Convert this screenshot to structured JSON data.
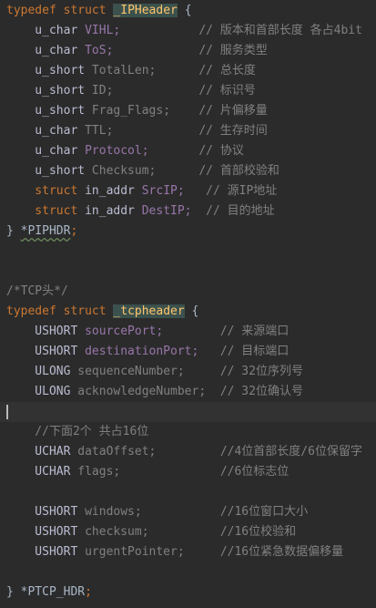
{
  "colors": {
    "background": "#2b2b2b",
    "keyword": "#cc7832",
    "type": "#b9bcd1",
    "field_purple": "#9876aa",
    "field_gray": "#808080",
    "comment": "#808080",
    "plain": "#a9b7c6",
    "struct_name": "#ffc66d",
    "current_line": "#323232",
    "brace_highlight": "#3b514d"
  },
  "lines": [
    {
      "tokens": [
        {
          "text": "typedef ",
          "c": "keyword"
        },
        {
          "text": "struct ",
          "c": "keyword"
        },
        {
          "text": "_IPHeader",
          "c": "struct_name",
          "hl": true
        },
        {
          "text": " {",
          "c": "plain"
        }
      ]
    },
    {
      "tokens": [
        {
          "text": "    u_char ",
          "c": "type"
        },
        {
          "text": "VIHL;",
          "c": "field_purple"
        },
        {
          "text": "           ",
          "c": "plain"
        },
        {
          "text": "// 版本和首部长度 各占4bit",
          "c": "comment"
        }
      ]
    },
    {
      "tokens": [
        {
          "text": "    u_char ",
          "c": "type"
        },
        {
          "text": "ToS;",
          "c": "field_purple"
        },
        {
          "text": "            ",
          "c": "plain"
        },
        {
          "text": "// 服务类型",
          "c": "comment"
        }
      ]
    },
    {
      "tokens": [
        {
          "text": "    u_short ",
          "c": "type"
        },
        {
          "text": "TotalLen;",
          "c": "field_gray"
        },
        {
          "text": "      ",
          "c": "plain"
        },
        {
          "text": "// 总长度",
          "c": "comment"
        }
      ]
    },
    {
      "tokens": [
        {
          "text": "    u_short ",
          "c": "type"
        },
        {
          "text": "ID;",
          "c": "field_gray"
        },
        {
          "text": "            ",
          "c": "plain"
        },
        {
          "text": "// 标识号",
          "c": "comment"
        }
      ]
    },
    {
      "tokens": [
        {
          "text": "    u_short ",
          "c": "type"
        },
        {
          "text": "Frag_Flags;",
          "c": "field_gray"
        },
        {
          "text": "    ",
          "c": "plain"
        },
        {
          "text": "// 片偏移量",
          "c": "comment"
        }
      ]
    },
    {
      "tokens": [
        {
          "text": "    u_char ",
          "c": "type"
        },
        {
          "text": "TTL;",
          "c": "field_gray"
        },
        {
          "text": "            ",
          "c": "plain"
        },
        {
          "text": "// 生存时间",
          "c": "comment"
        }
      ]
    },
    {
      "tokens": [
        {
          "text": "    u_char ",
          "c": "type"
        },
        {
          "text": "Protocol;",
          "c": "field_purple"
        },
        {
          "text": "       ",
          "c": "plain"
        },
        {
          "text": "// 协议",
          "c": "comment"
        }
      ]
    },
    {
      "tokens": [
        {
          "text": "    u_short ",
          "c": "type"
        },
        {
          "text": "Checksum;",
          "c": "field_gray"
        },
        {
          "text": "      ",
          "c": "plain"
        },
        {
          "text": "// 首部校验和",
          "c": "comment"
        }
      ]
    },
    {
      "tokens": [
        {
          "text": "    struct ",
          "c": "keyword"
        },
        {
          "text": "in_addr ",
          "c": "type"
        },
        {
          "text": "SrcIP;",
          "c": "field_purple"
        },
        {
          "text": "   ",
          "c": "plain"
        },
        {
          "text": "// 源IP地址",
          "c": "comment"
        }
      ]
    },
    {
      "tokens": [
        {
          "text": "    struct ",
          "c": "keyword"
        },
        {
          "text": "in_addr ",
          "c": "type"
        },
        {
          "text": "DestIP;",
          "c": "field_purple"
        },
        {
          "text": "  ",
          "c": "plain"
        },
        {
          "text": "// 目的地址",
          "c": "comment"
        }
      ]
    },
    {
      "tokens": [
        {
          "text": "} ",
          "c": "plain"
        },
        {
          "text": "*PIPHDR",
          "c": "plain",
          "squiggle": true
        },
        {
          "text": ";",
          "c": "keyword"
        }
      ]
    },
    {
      "tokens": []
    },
    {
      "tokens": []
    },
    {
      "tokens": [
        {
          "text": "/*TCP头*/",
          "c": "comment"
        }
      ]
    },
    {
      "tokens": [
        {
          "text": "typedef ",
          "c": "keyword"
        },
        {
          "text": "struct ",
          "c": "keyword"
        },
        {
          "text": "_tcpheader",
          "c": "struct_name",
          "hl": true
        },
        {
          "text": " {",
          "c": "plain"
        }
      ]
    },
    {
      "tokens": [
        {
          "text": "    USHORT ",
          "c": "type"
        },
        {
          "text": "sourcePort;",
          "c": "field_purple"
        },
        {
          "text": "        ",
          "c": "plain"
        },
        {
          "text": "// 来源端口",
          "c": "comment"
        }
      ]
    },
    {
      "tokens": [
        {
          "text": "    USHORT ",
          "c": "type"
        },
        {
          "text": "destinationPort;",
          "c": "field_purple"
        },
        {
          "text": "   ",
          "c": "plain"
        },
        {
          "text": "// 目标端口",
          "c": "comment"
        }
      ]
    },
    {
      "tokens": [
        {
          "text": "    ULONG ",
          "c": "type"
        },
        {
          "text": "sequenceNumber;",
          "c": "field_gray"
        },
        {
          "text": "     ",
          "c": "plain"
        },
        {
          "text": "// 32位序列号",
          "c": "comment"
        }
      ]
    },
    {
      "tokens": [
        {
          "text": "    ULONG ",
          "c": "type"
        },
        {
          "text": "acknowledgeNumber;",
          "c": "field_gray"
        },
        {
          "text": "  ",
          "c": "plain"
        },
        {
          "text": "// 32位确认号",
          "c": "comment"
        }
      ]
    },
    {
      "tokens": [],
      "current": true
    },
    {
      "tokens": [
        {
          "text": "    //下面2个 共占16位",
          "c": "comment"
        }
      ]
    },
    {
      "tokens": [
        {
          "text": "    UCHAR ",
          "c": "type"
        },
        {
          "text": "dataOffset;",
          "c": "field_gray"
        },
        {
          "text": "         ",
          "c": "plain"
        },
        {
          "text": "//4位首部长度/6位保留字",
          "c": "comment"
        }
      ]
    },
    {
      "tokens": [
        {
          "text": "    UCHAR ",
          "c": "type"
        },
        {
          "text": "flags;",
          "c": "field_gray"
        },
        {
          "text": "              ",
          "c": "plain"
        },
        {
          "text": "//6位标志位",
          "c": "comment"
        }
      ]
    },
    {
      "tokens": []
    },
    {
      "tokens": [
        {
          "text": "    USHORT ",
          "c": "type"
        },
        {
          "text": "windows;",
          "c": "field_gray"
        },
        {
          "text": "           ",
          "c": "plain"
        },
        {
          "text": "//16位窗口大小",
          "c": "comment"
        }
      ]
    },
    {
      "tokens": [
        {
          "text": "    USHORT ",
          "c": "type"
        },
        {
          "text": "checksum;",
          "c": "field_gray"
        },
        {
          "text": "          ",
          "c": "plain"
        },
        {
          "text": "//16位校验和",
          "c": "comment"
        }
      ]
    },
    {
      "tokens": [
        {
          "text": "    USHORT ",
          "c": "type"
        },
        {
          "text": "urgentPointer;",
          "c": "field_gray"
        },
        {
          "text": "     ",
          "c": "plain"
        },
        {
          "text": "//16位紧急数据偏移量",
          "c": "comment"
        }
      ]
    },
    {
      "tokens": []
    },
    {
      "tokens": [
        {
          "text": "} ",
          "c": "plain"
        },
        {
          "text": "*PTCP_HDR",
          "c": "plain"
        },
        {
          "text": ";",
          "c": "keyword"
        }
      ]
    }
  ]
}
